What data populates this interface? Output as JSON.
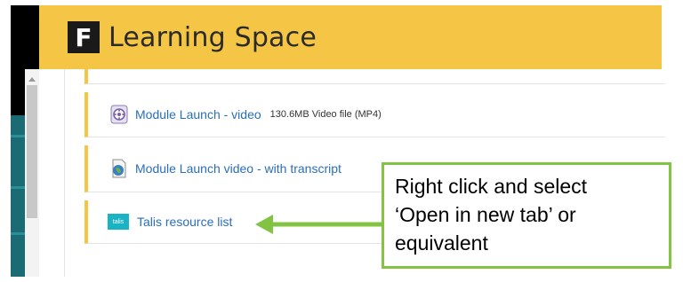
{
  "header": {
    "logo_letter": "F",
    "title": "Learning Space"
  },
  "items": [
    {
      "label": "Module Launch - video",
      "meta": "130.6MB Video file (MP4)",
      "icon": "video-file-icon"
    },
    {
      "label": "Module Launch video - with transcript",
      "icon": "transcript-document-icon"
    },
    {
      "label": "Talis resource list",
      "icon": "talis-logo-icon",
      "icon_text": "talis"
    }
  ],
  "callout": {
    "lines": [
      "Right click and select",
      "‘Open in new tab’ or",
      "equivalent"
    ]
  },
  "colors": {
    "header_bg": "#f5c646",
    "link": "#2a6ebb",
    "accent_border": "#f5c646",
    "callout_border": "#82c341",
    "arrow": "#82c341",
    "talis": "#1ab3c4"
  }
}
